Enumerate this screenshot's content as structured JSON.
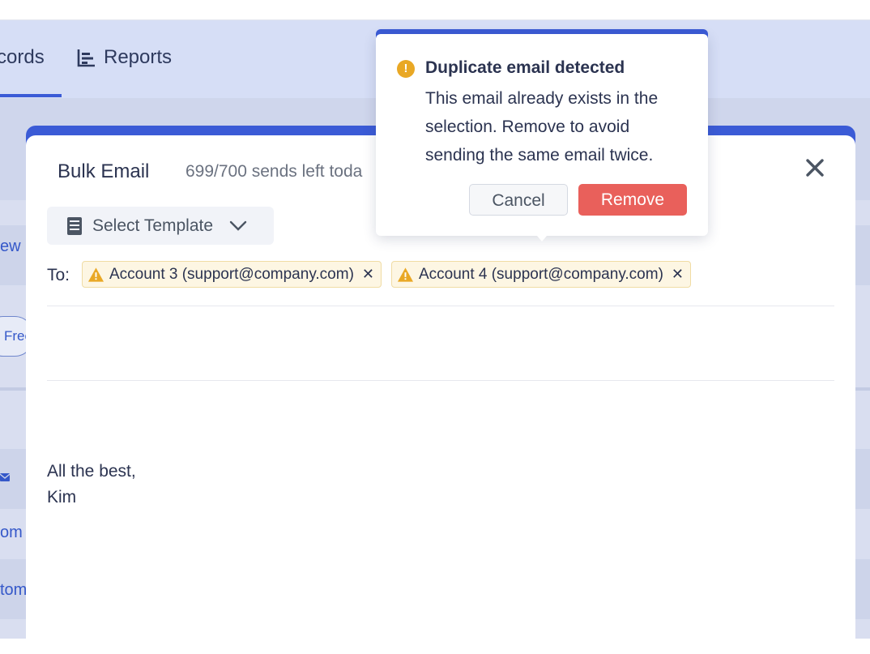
{
  "nav": {
    "tabs": [
      {
        "label": "cords",
        "active": true
      },
      {
        "label": "Reports",
        "icon": "bar-chart-icon"
      }
    ]
  },
  "background": {
    "fragments": [
      "ew",
      "Free",
      "om",
      "tom"
    ],
    "mail_icon": "envelope-icon"
  },
  "modal": {
    "title": "Bulk Email",
    "subtitle": "699/700 sends left toda",
    "close_icon": "close-icon",
    "template_button": {
      "label": "Select Template",
      "icon": "document-icon",
      "chevron": "chevron-down-icon"
    },
    "to_label": "To:",
    "recipients": [
      {
        "label": "Account 3 (support@company.com)",
        "icon": "warning-icon",
        "remove": "✕"
      },
      {
        "label": "Account 4 (support@company.com)",
        "icon": "warning-icon",
        "remove": "✕"
      }
    ],
    "body_lines": [
      "All the best,",
      "Kim"
    ]
  },
  "popover": {
    "icon": "warning-circle-icon",
    "icon_glyph": "!",
    "title": "Duplicate email detected",
    "message": "This email already exists in the selection. Remove to avoid sending the same email twice.",
    "cancel_label": "Cancel",
    "remove_label": "Remove"
  },
  "colors": {
    "accent": "#3b5bd6",
    "warning": "#e9a825",
    "danger": "#e9605b"
  }
}
